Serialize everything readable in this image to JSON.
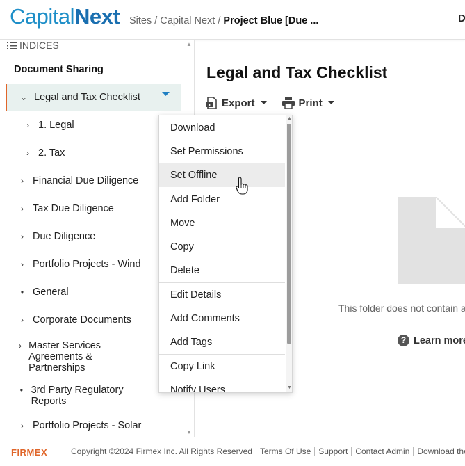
{
  "header": {
    "logo_part1": "Capital",
    "logo_part2": "Next",
    "breadcrumb": [
      "Sites",
      "Capital Next"
    ],
    "breadcrumb_sep": "/",
    "breadcrumb_current": "Project Blue [Due ...",
    "right_letter": "D"
  },
  "sidebar": {
    "indices_label": "INDICES",
    "section_title": "Document Sharing",
    "items": [
      {
        "label": "Legal and Tax Checklist",
        "icon": "chevron-down-icon"
      },
      {
        "label": "1. Legal",
        "icon": "chevron-right-icon"
      },
      {
        "label": "2. Tax",
        "icon": "chevron-right-icon"
      },
      {
        "label": "Financial Due Diligence",
        "icon": "chevron-right-icon"
      },
      {
        "label": "Tax Due Diligence",
        "icon": "chevron-right-icon"
      },
      {
        "label": "Due Diligence",
        "icon": "chevron-right-icon"
      },
      {
        "label": "Portfolio Projects - Wind",
        "icon": "chevron-right-icon"
      },
      {
        "label": "General",
        "icon": "bullet-icon"
      },
      {
        "label": "Corporate Documents",
        "icon": "chevron-right-icon"
      },
      {
        "label": "Master Services Agreements & Partnerships",
        "icon": "chevron-right-icon"
      },
      {
        "label": "3rd Party Regulatory Reports",
        "icon": "bullet-icon"
      },
      {
        "label": "Portfolio Projects - Solar",
        "icon": "chevron-right-icon"
      }
    ]
  },
  "main": {
    "title": "Legal and Tax Checklist",
    "export_label": "Export",
    "print_label": "Print",
    "empty_message": "This folder does not contain a",
    "learn_more": "Learn more"
  },
  "context_menu": {
    "items": [
      "Download",
      "Set Permissions",
      "Set Offline",
      "Add Folder",
      "Move",
      "Copy",
      "Delete",
      "Edit Details",
      "Add Comments",
      "Add Tags",
      "Copy Link",
      "Notify Users"
    ],
    "hovered": "Set Offline"
  },
  "footer": {
    "brand": "FIRMEX",
    "copyright": "Copyright ©2024 Firmex Inc. All Rights Reserved",
    "links": [
      "Terms Of Use",
      "Support",
      "Contact Admin",
      "Download the"
    ]
  },
  "colors": {
    "accent_orange": "#e0662a",
    "brand_blue": "#1f8fc8",
    "selected_bg": "#e8f1ef"
  }
}
